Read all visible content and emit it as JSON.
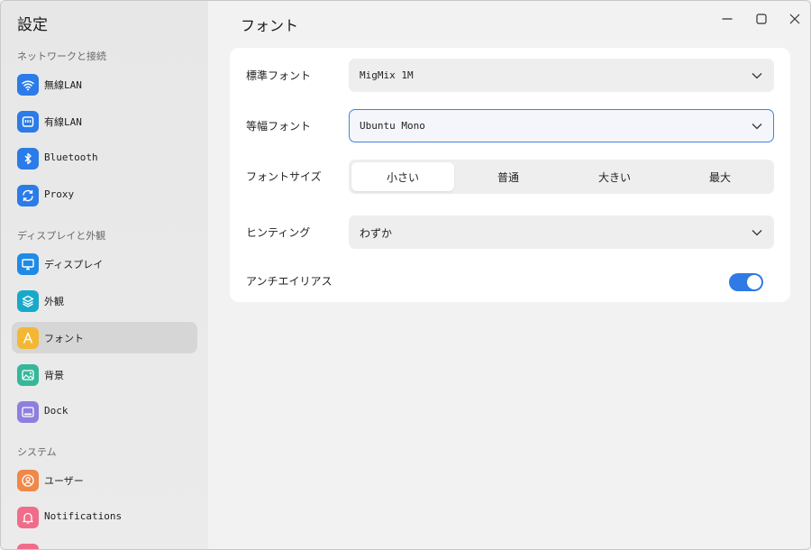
{
  "app": {
    "title": "設定"
  },
  "sidebar": {
    "sections": [
      {
        "label": "ネットワークと接続"
      },
      {
        "label": "ディスプレイと外観"
      },
      {
        "label": "システム"
      }
    ],
    "items": [
      {
        "label": "無線LAN",
        "icon": "wifi-icon",
        "color": "#2b7be8"
      },
      {
        "label": "有線LAN",
        "icon": "ethernet-icon",
        "color": "#2b7be8"
      },
      {
        "label": "Bluetooth",
        "icon": "bluetooth-icon",
        "color": "#2b7be8"
      },
      {
        "label": "Proxy",
        "icon": "proxy-sync-icon",
        "color": "#2b7be8"
      },
      {
        "label": "ディスプレイ",
        "icon": "monitor-icon",
        "color": "#1f8be6"
      },
      {
        "label": "外観",
        "icon": "layers-icon",
        "color": "#18a9c9"
      },
      {
        "label": "フォント",
        "icon": "font-a-icon",
        "color": "#f3b733",
        "active": true
      },
      {
        "label": "背景",
        "icon": "image-icon",
        "color": "#36b79a"
      },
      {
        "label": "Dock",
        "icon": "dock-icon",
        "color": "#8e7ee0"
      },
      {
        "label": "ユーザー",
        "icon": "user-icon",
        "color": "#f0884a"
      },
      {
        "label": "Notifications",
        "icon": "bell-icon",
        "color": "#f06d8a"
      }
    ]
  },
  "main": {
    "title": "フォント",
    "standard_font": {
      "label": "標準フォント",
      "value": "MigMix 1M"
    },
    "mono_font": {
      "label": "等幅フォント",
      "value": "Ubuntu Mono"
    },
    "font_size": {
      "label": "フォントサイズ",
      "options": [
        "小さい",
        "普通",
        "大きい",
        "最大"
      ],
      "selected": "小さい"
    },
    "hinting": {
      "label": "ヒンティング",
      "value": "わずか"
    },
    "antialias": {
      "label": "アンチエイリアス",
      "enabled": true
    }
  },
  "colors": {
    "accent": "#2f7ae5",
    "sidebar_bg": "#e9e9e9",
    "card_bg": "#ffffff"
  }
}
